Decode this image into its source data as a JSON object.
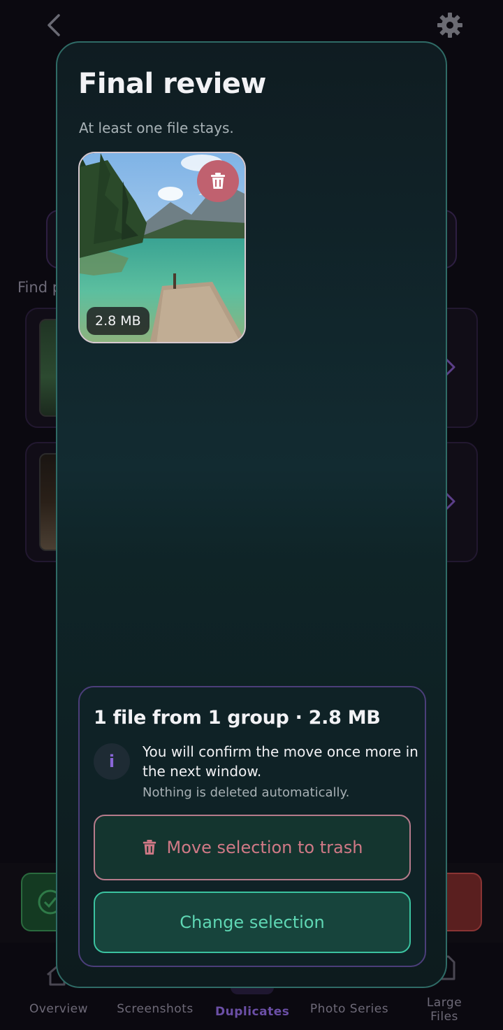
{
  "background": {
    "find_label": "Find p",
    "nav": {
      "items": [
        {
          "label": "Overview",
          "icon": "home-icon"
        },
        {
          "label": "Screenshots",
          "icon": "screenshot-icon"
        },
        {
          "label": "Duplicates",
          "icon": "duplicates-icon",
          "active": true
        },
        {
          "label": "Photo Series",
          "icon": "series-icon"
        },
        {
          "label_line1": "Large",
          "label_line2": "Files",
          "icon": "file-icon"
        }
      ]
    }
  },
  "modal": {
    "title": "Final review",
    "subtitle": "At least one file stays.",
    "photo": {
      "size": "2.8 MB",
      "delete_icon": "trash-icon"
    },
    "summary": {
      "title": "1 file from 1 group · 2.8 MB",
      "info_badge": "i",
      "info_main": "You will confirm the move once more in the next window.",
      "info_sub": "Nothing is deleted automatically.",
      "trash_button": "Move selection to trash",
      "change_button": "Change selection"
    }
  },
  "colors": {
    "accent_teal": "#5fd7b4",
    "danger_pink": "#d07986",
    "active_nav": "#6b4fa6",
    "modal_border": "#2f6b66"
  }
}
